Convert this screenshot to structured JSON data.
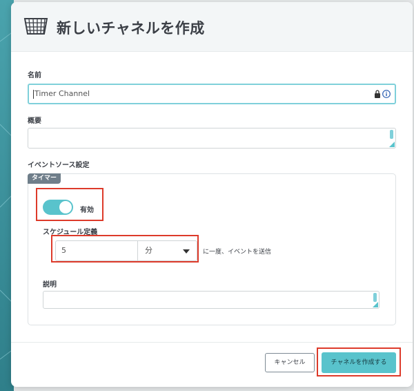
{
  "modal": {
    "title": "新しいチャネルを作成",
    "icon": "channel-net-icon"
  },
  "form": {
    "name_label": "名前",
    "name_value": "Timer Channel",
    "summary_label": "概要",
    "summary_value": "",
    "event_source_label": "イベントソース設定",
    "timer_tab": "タイマー",
    "enabled_label": "有効",
    "enabled": true,
    "schedule_label": "スケジュール定義",
    "schedule_value": "5",
    "schedule_unit": "分",
    "schedule_suffix": "に一度、イベントを送信",
    "explanation_label": "説明",
    "explanation_value": ""
  },
  "footer": {
    "cancel_label": "キャンセル",
    "create_label": "チャネルを作成する"
  },
  "colors": {
    "accent": "#59c3cc",
    "highlight": "#dd3a2a",
    "title_text": "#3b3f46"
  }
}
